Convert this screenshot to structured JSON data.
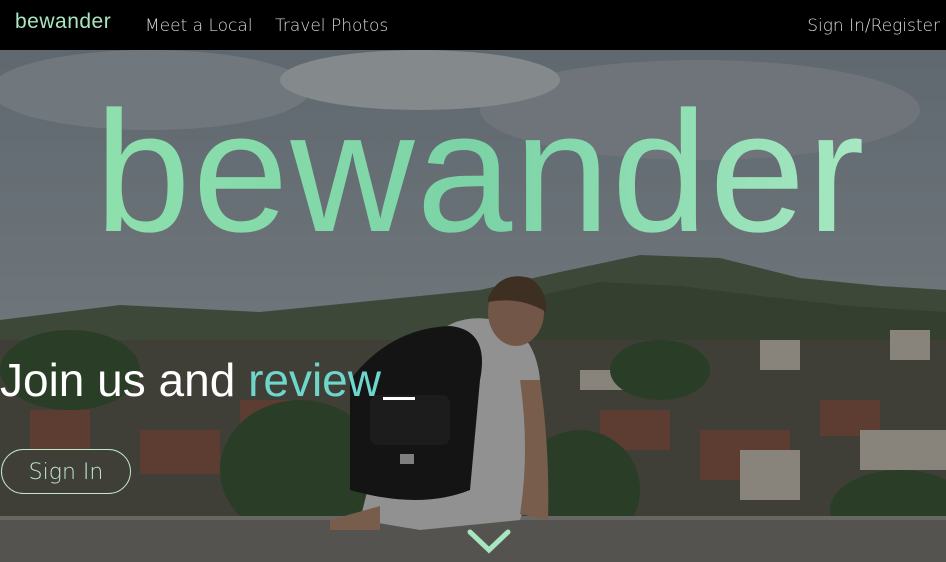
{
  "nav": {
    "brand": "bewander",
    "links": [
      "Meet a Local",
      "Travel Photos"
    ],
    "signin": "Sign In/Register"
  },
  "hero": {
    "logo_text": "bewander",
    "tagline_prefix": "Join us and",
    "tagline_word": "review",
    "signin_button": "Sign In"
  },
  "colors": {
    "brand_green": "#a8e6c0",
    "accent_teal": "#6fd6cc",
    "nav_bg": "#000000"
  },
  "icons": [
    "chevron-down-icon"
  ]
}
